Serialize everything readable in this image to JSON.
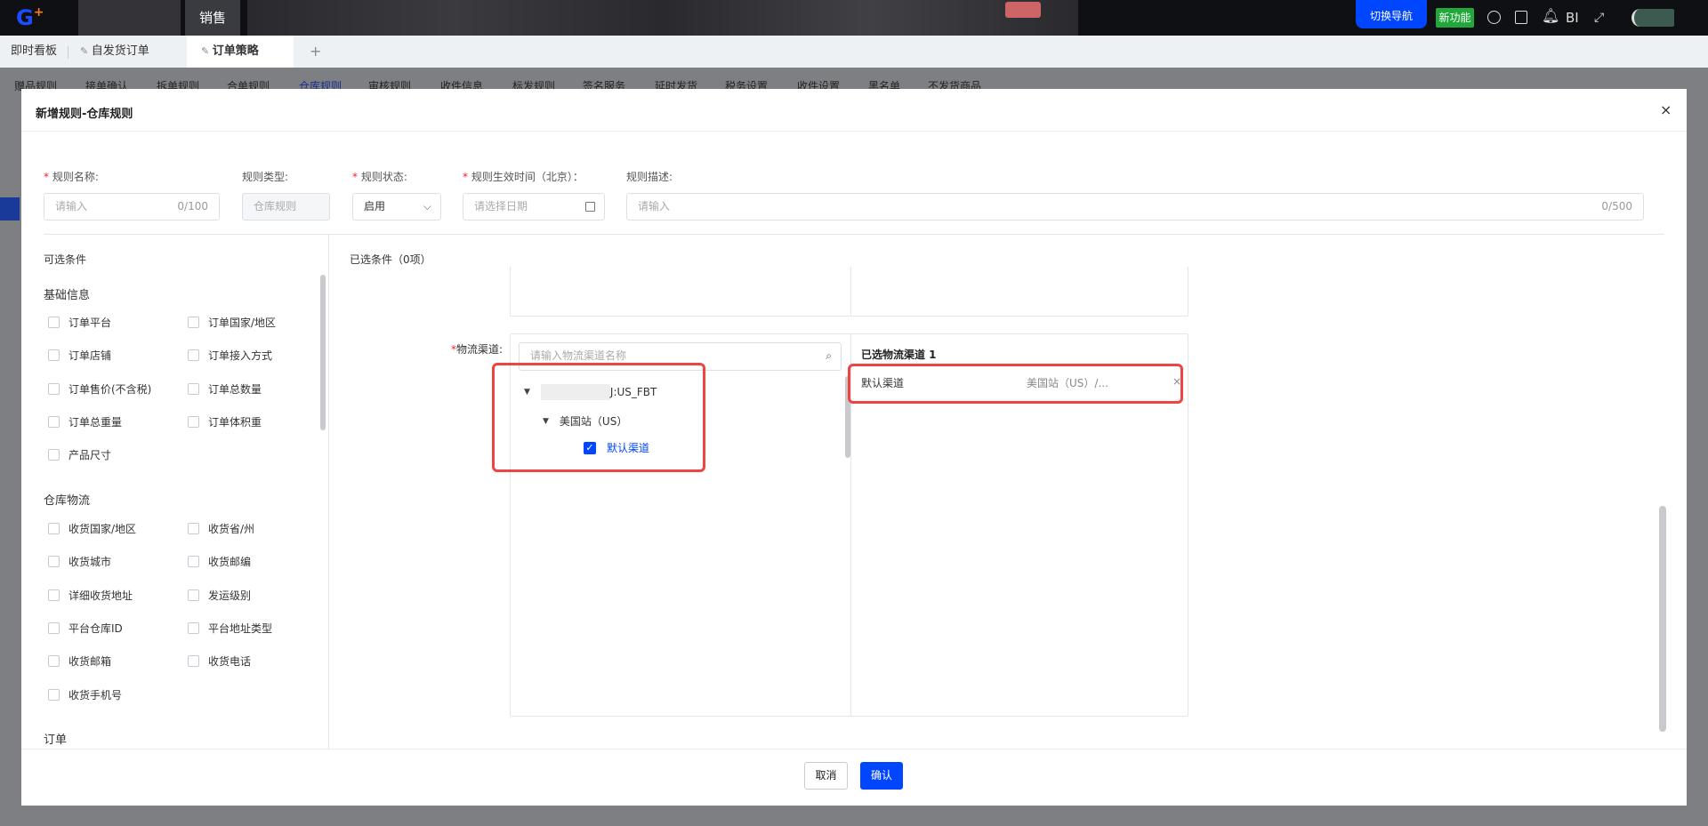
{
  "topbar": {
    "module": "销售",
    "switch_nav": "切换导航",
    "new_feature": "新功能",
    "bi": "BI",
    "colors": {
      "accent": "#0046ff",
      "green": "#22a83a"
    }
  },
  "tabs": [
    {
      "label": "即时看板"
    },
    {
      "label": "自发货订单"
    },
    {
      "label": "订单策略"
    }
  ],
  "add_tab": "+",
  "subnav": [
    "赠品规则",
    "接单确认",
    "拆单规则",
    "合单规则",
    "仓库规则",
    "审核规则",
    "收件信息",
    "标发规则",
    "签名服务",
    "延时发货",
    "税务设置",
    "收件设置",
    "黑名单",
    "不发货商品"
  ],
  "modal": {
    "title": "新增规则-仓库规则",
    "close": "×",
    "form": {
      "name_label": "规则名称:",
      "name_placeholder": "请输入",
      "name_count": "0/100",
      "type_label": "规则类型:",
      "type_value": "仓库规则",
      "status_label": "规则状态:",
      "status_value": "启用",
      "time_label": "规则生效时间（北京）：",
      "time_placeholder": "请选择日期",
      "desc_label": "规则描述:",
      "desc_placeholder": "请输入",
      "desc_count": "0/500"
    },
    "left": {
      "title": "可选条件",
      "groups": [
        {
          "name": "基础信息",
          "items": [
            "订单平台",
            "订单国家/地区",
            "订单店铺",
            "订单接入方式",
            "订单售价(不含税)",
            "订单总数量",
            "订单总重量",
            "订单体积重",
            "产品尺寸"
          ]
        },
        {
          "name": "仓库物流",
          "items": [
            "收货国家/地区",
            "收货省/州",
            "收货城市",
            "收货邮编",
            "详细收货地址",
            "发运级别",
            "平台仓库ID",
            "平台地址类型",
            "收货邮箱",
            "收货电话",
            "收货手机号"
          ]
        },
        {
          "name": "订单",
          "items": []
        }
      ]
    },
    "right": {
      "title": "已选条件（0项）",
      "channel_label": "物流渠道:",
      "search_placeholder": "请输入物流渠道名称",
      "tree": {
        "root": "J:US_FBT",
        "site": "美国站（US）",
        "channel": "默认渠道"
      },
      "selected_title": "已选物流渠道 1",
      "selected": [
        {
          "name": "默认渠道",
          "path": "美国站（US）/..."
        }
      ]
    },
    "footer": {
      "cancel": "取消",
      "confirm": "确认"
    }
  }
}
